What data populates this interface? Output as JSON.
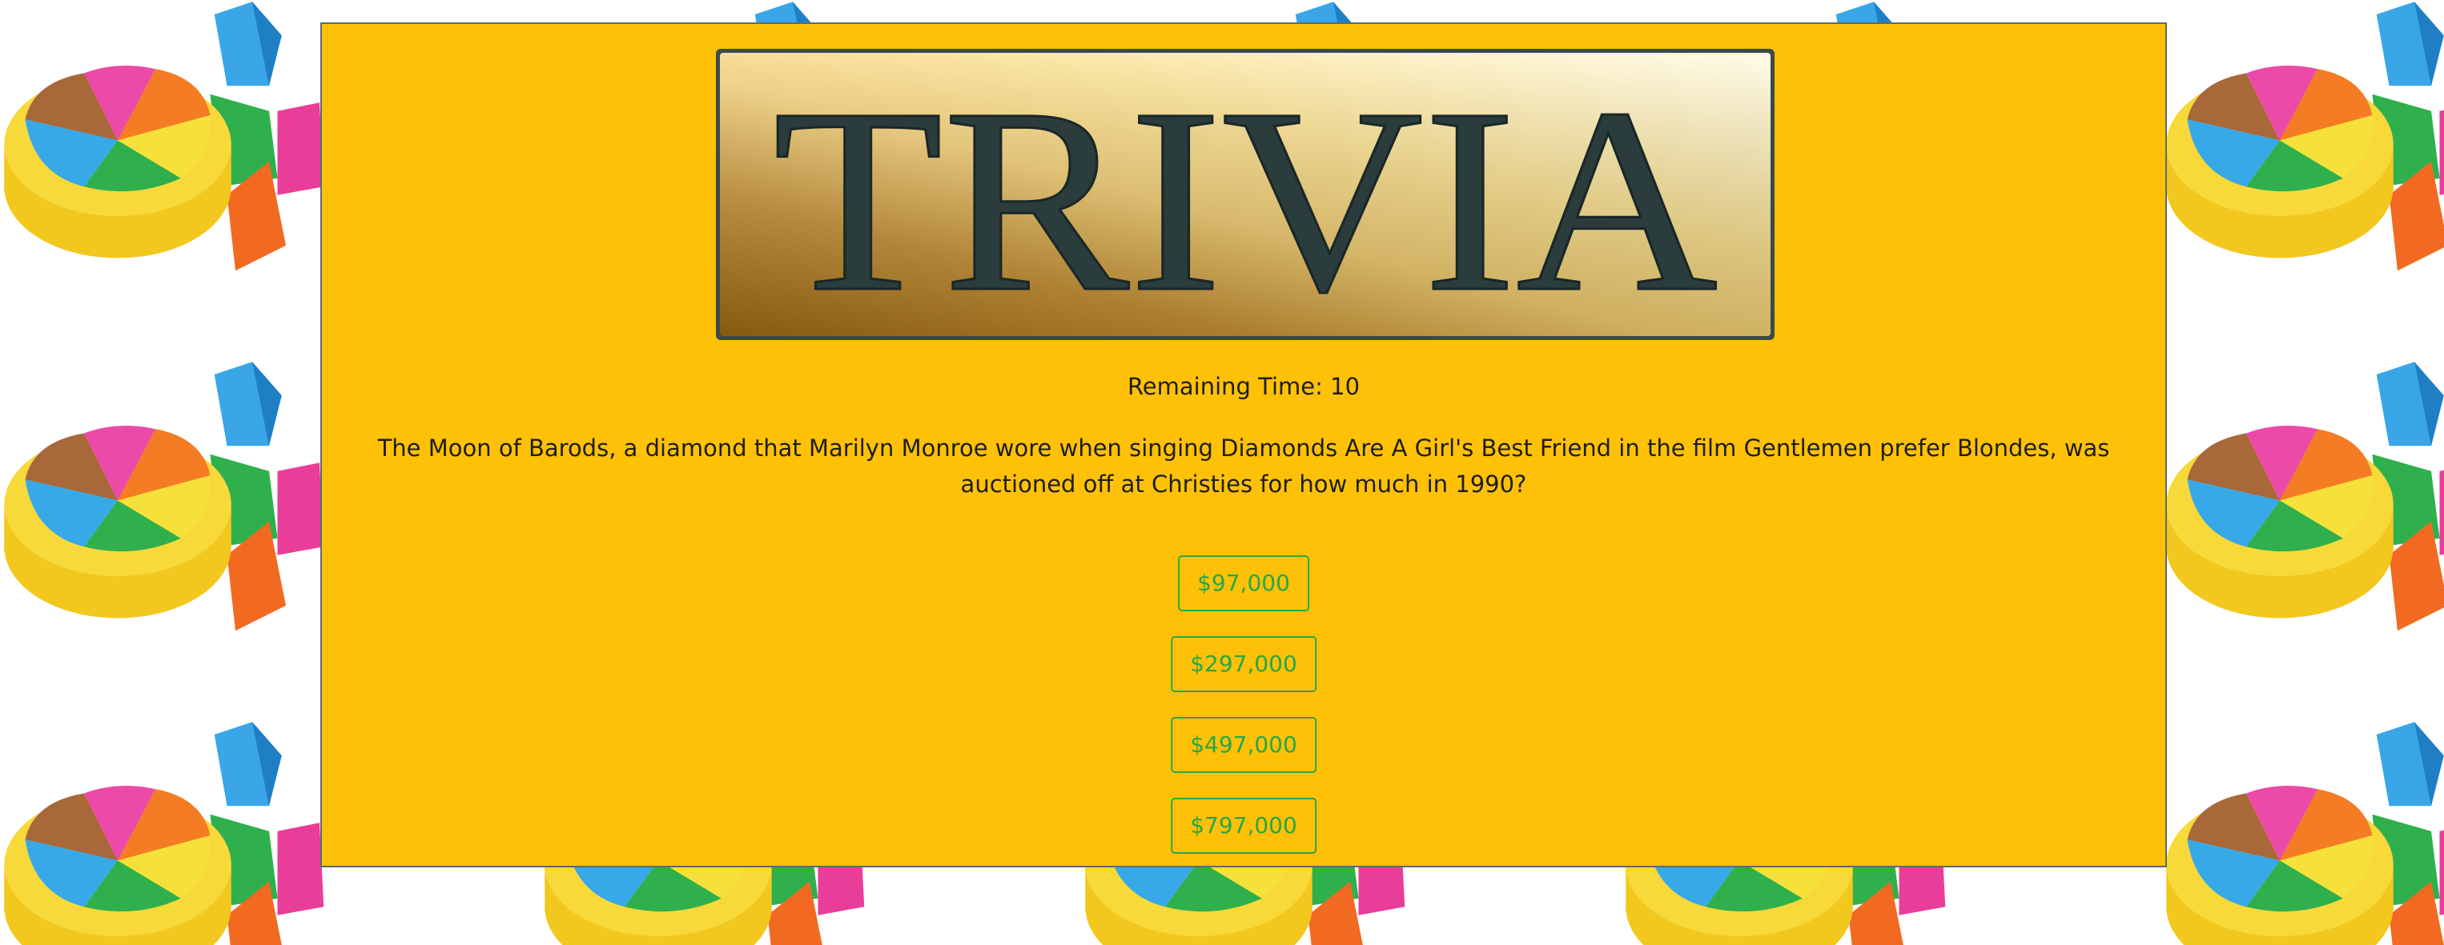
{
  "logo": {
    "text": "TRIVIA"
  },
  "timer": {
    "label": "Remaining Time:",
    "seconds": "10",
    "text": "Remaining Time: 10"
  },
  "question": {
    "text": "The Moon of Barods, a diamond that Marilyn Monroe wore when singing Diamonds Are A Girl's Best Friend in the film Gentlemen prefer Blondes, was auctioned off at Christies for how much in 1990?"
  },
  "answers": [
    {
      "label": "$97,000"
    },
    {
      "label": "$297,000"
    },
    {
      "label": "$497,000"
    },
    {
      "label": "$797,000"
    }
  ],
  "colors": {
    "panel": "#fec107",
    "answer_outline": "#28a745",
    "logo_text": "#2a3c3c"
  },
  "background": {
    "icon": "trivia-pie-pieces-icon"
  }
}
